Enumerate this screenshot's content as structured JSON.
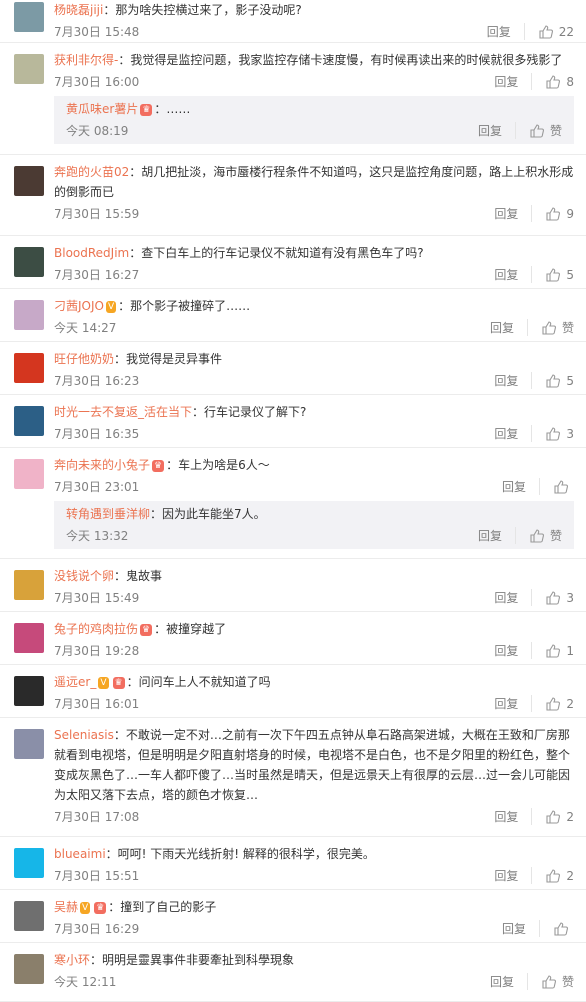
{
  "ui": {
    "reply": "回复",
    "like": "赞"
  },
  "comments": [
    {
      "user": "杨晓磊jiji",
      "text": "那为啥失控横过来了，影子没动呢?",
      "time": "7月30日 15:48",
      "likes": "22",
      "avatar": "#7c9aa5",
      "badges": []
    },
    {
      "user": "获利非尔得-",
      "text": "我觉得是监控问题，我家监控存储卡速度慢，有时候再读出来的时候就很多残影了",
      "time": "7月30日 16:00",
      "likes": "8",
      "avatar": "#b8b89b",
      "badges": [],
      "sub": {
        "user": "黄瓜味er薯片",
        "text": "……",
        "time": "今天 08:19",
        "likes": "赞",
        "badges": [
          "vip"
        ]
      }
    },
    {
      "user": "奔跑的火苗02",
      "text": "胡几把扯淡，海市蜃楼行程条件不知道吗，这只是监控角度问题，路上上积水形成的倒影而已",
      "time": "7月30日 15:59",
      "likes": "9",
      "avatar": "#4b3a33",
      "badges": []
    },
    {
      "user": "BloodRedJim",
      "text": "查下白车上的行车记录仪不就知道有没有黑色车了吗?",
      "time": "7月30日 16:27",
      "likes": "5",
      "avatar": "#3c4d44",
      "badges": []
    },
    {
      "user": "刁茜JOJO",
      "text": "那个影子被撞碎了……",
      "time": "今天 14:27",
      "likes": "赞",
      "avatar": "#c7a9c8",
      "badges": [
        "v"
      ]
    },
    {
      "user": "旺仔他奶奶",
      "text": "我觉得是灵异事件",
      "time": "7月30日 16:23",
      "likes": "5",
      "avatar": "#d4361f",
      "badges": []
    },
    {
      "user": "时光一去不复返_活在当下",
      "text": "行车记录仪了解下?",
      "time": "7月30日 16:35",
      "likes": "3",
      "avatar": "#2c5f86",
      "badges": []
    },
    {
      "user": "奔向未来的小兔子",
      "text": "车上为啥是6人～",
      "time": "7月30日 23:01",
      "likes": "",
      "avatar": "#f0b3c8",
      "badges": [
        "vip"
      ],
      "sub": {
        "user": "转角遇到垂洋柳",
        "text": "因为此车能坐7人。",
        "time": "今天 13:32",
        "likes": "赞",
        "badges": []
      }
    },
    {
      "user": "没钱说个卵",
      "text": "鬼故事",
      "time": "7月30日 15:49",
      "likes": "3",
      "avatar": "#d8a23a",
      "badges": []
    },
    {
      "user": "兔子的鸡肉拉伤",
      "text": "被撞穿越了",
      "time": "7月30日 19:28",
      "likes": "1",
      "avatar": "#c64a7b",
      "badges": [
        "vip"
      ]
    },
    {
      "user": "遥远er_",
      "text": "问问车上人不就知道了吗",
      "time": "7月30日 16:01",
      "likes": "2",
      "avatar": "#2a2a2a",
      "badges": [
        "v",
        "vip"
      ]
    },
    {
      "user": "Seleniasis",
      "text": "不敢说一定不对…之前有一次下午四五点钟从阜石路高架进城，大概在王致和厂房那就看到电视塔，但是明明是夕阳直射塔身的时候，电视塔不是白色，也不是夕阳里的粉红色，整个变成灰黑色了…一车人都吓傻了…当时虽然是晴天，但是远景天上有很厚的云层…过一会儿可能因为太阳又落下去点，塔的颜色才恢复…",
      "time": "7月30日 17:08",
      "likes": "2",
      "avatar": "#8a8fa8",
      "badges": []
    },
    {
      "user": "blueaimi",
      "text": "呵呵! 下雨天光线折射! 解释的很科学，很完美。",
      "time": "7月30日 15:51",
      "likes": "2",
      "avatar": "#16b6e8",
      "badges": []
    },
    {
      "user": "吴赫",
      "text": "撞到了自己的影子",
      "time": "7月30日 16:29",
      "likes": "",
      "avatar": "#6f6f6f",
      "badges": [
        "v",
        "vip"
      ]
    },
    {
      "user": "寒小环",
      "text": "明明是靈異事件非要牽扯到科學現象",
      "time": "今天 12:11",
      "likes": "赞",
      "avatar": "#8a7f6b",
      "badges": []
    }
  ]
}
